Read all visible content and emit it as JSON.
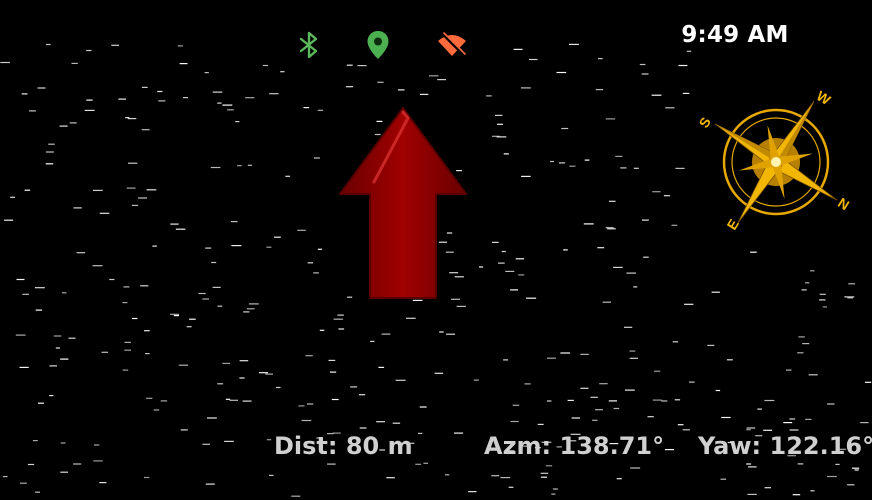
{
  "status_bar": {
    "time": "9:49 AM",
    "icons": [
      {
        "name": "bluetooth-icon",
        "color": "#5cb85c"
      },
      {
        "name": "location-pin-icon",
        "color": "#4caf50"
      },
      {
        "name": "wifi-off-icon",
        "color": "#ff6a3d"
      }
    ]
  },
  "direction_arrow": {
    "icon": "arrow-up-icon",
    "color": "#8b0000"
  },
  "compass": {
    "icon": "compass-rose-icon",
    "color": "#f2b705",
    "letters": {
      "north": "N",
      "south": "S",
      "east": "E",
      "west": "W"
    }
  },
  "readouts": {
    "distance": "Dist: 80 m",
    "azimuth": "Azm: 138.71°",
    "yaw": "Yaw: 122.16°"
  }
}
